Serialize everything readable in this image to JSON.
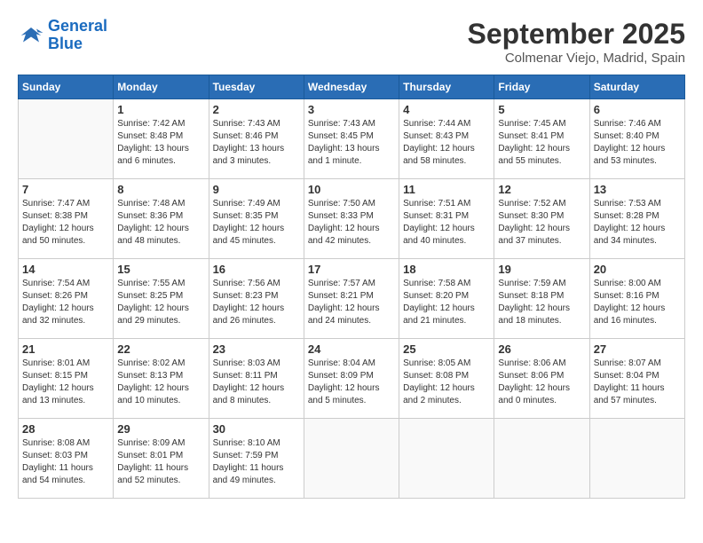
{
  "header": {
    "logo_line1": "General",
    "logo_line2": "Blue",
    "month_title": "September 2025",
    "location": "Colmenar Viejo, Madrid, Spain"
  },
  "weekdays": [
    "Sunday",
    "Monday",
    "Tuesday",
    "Wednesday",
    "Thursday",
    "Friday",
    "Saturday"
  ],
  "weeks": [
    [
      {
        "day": "",
        "sunrise": "",
        "sunset": "",
        "daylight": ""
      },
      {
        "day": "1",
        "sunrise": "Sunrise: 7:42 AM",
        "sunset": "Sunset: 8:48 PM",
        "daylight": "Daylight: 13 hours and 6 minutes."
      },
      {
        "day": "2",
        "sunrise": "Sunrise: 7:43 AM",
        "sunset": "Sunset: 8:46 PM",
        "daylight": "Daylight: 13 hours and 3 minutes."
      },
      {
        "day": "3",
        "sunrise": "Sunrise: 7:43 AM",
        "sunset": "Sunset: 8:45 PM",
        "daylight": "Daylight: 13 hours and 1 minute."
      },
      {
        "day": "4",
        "sunrise": "Sunrise: 7:44 AM",
        "sunset": "Sunset: 8:43 PM",
        "daylight": "Daylight: 12 hours and 58 minutes."
      },
      {
        "day": "5",
        "sunrise": "Sunrise: 7:45 AM",
        "sunset": "Sunset: 8:41 PM",
        "daylight": "Daylight: 12 hours and 55 minutes."
      },
      {
        "day": "6",
        "sunrise": "Sunrise: 7:46 AM",
        "sunset": "Sunset: 8:40 PM",
        "daylight": "Daylight: 12 hours and 53 minutes."
      }
    ],
    [
      {
        "day": "7",
        "sunrise": "Sunrise: 7:47 AM",
        "sunset": "Sunset: 8:38 PM",
        "daylight": "Daylight: 12 hours and 50 minutes."
      },
      {
        "day": "8",
        "sunrise": "Sunrise: 7:48 AM",
        "sunset": "Sunset: 8:36 PM",
        "daylight": "Daylight: 12 hours and 48 minutes."
      },
      {
        "day": "9",
        "sunrise": "Sunrise: 7:49 AM",
        "sunset": "Sunset: 8:35 PM",
        "daylight": "Daylight: 12 hours and 45 minutes."
      },
      {
        "day": "10",
        "sunrise": "Sunrise: 7:50 AM",
        "sunset": "Sunset: 8:33 PM",
        "daylight": "Daylight: 12 hours and 42 minutes."
      },
      {
        "day": "11",
        "sunrise": "Sunrise: 7:51 AM",
        "sunset": "Sunset: 8:31 PM",
        "daylight": "Daylight: 12 hours and 40 minutes."
      },
      {
        "day": "12",
        "sunrise": "Sunrise: 7:52 AM",
        "sunset": "Sunset: 8:30 PM",
        "daylight": "Daylight: 12 hours and 37 minutes."
      },
      {
        "day": "13",
        "sunrise": "Sunrise: 7:53 AM",
        "sunset": "Sunset: 8:28 PM",
        "daylight": "Daylight: 12 hours and 34 minutes."
      }
    ],
    [
      {
        "day": "14",
        "sunrise": "Sunrise: 7:54 AM",
        "sunset": "Sunset: 8:26 PM",
        "daylight": "Daylight: 12 hours and 32 minutes."
      },
      {
        "day": "15",
        "sunrise": "Sunrise: 7:55 AM",
        "sunset": "Sunset: 8:25 PM",
        "daylight": "Daylight: 12 hours and 29 minutes."
      },
      {
        "day": "16",
        "sunrise": "Sunrise: 7:56 AM",
        "sunset": "Sunset: 8:23 PM",
        "daylight": "Daylight: 12 hours and 26 minutes."
      },
      {
        "day": "17",
        "sunrise": "Sunrise: 7:57 AM",
        "sunset": "Sunset: 8:21 PM",
        "daylight": "Daylight: 12 hours and 24 minutes."
      },
      {
        "day": "18",
        "sunrise": "Sunrise: 7:58 AM",
        "sunset": "Sunset: 8:20 PM",
        "daylight": "Daylight: 12 hours and 21 minutes."
      },
      {
        "day": "19",
        "sunrise": "Sunrise: 7:59 AM",
        "sunset": "Sunset: 8:18 PM",
        "daylight": "Daylight: 12 hours and 18 minutes."
      },
      {
        "day": "20",
        "sunrise": "Sunrise: 8:00 AM",
        "sunset": "Sunset: 8:16 PM",
        "daylight": "Daylight: 12 hours and 16 minutes."
      }
    ],
    [
      {
        "day": "21",
        "sunrise": "Sunrise: 8:01 AM",
        "sunset": "Sunset: 8:15 PM",
        "daylight": "Daylight: 12 hours and 13 minutes."
      },
      {
        "day": "22",
        "sunrise": "Sunrise: 8:02 AM",
        "sunset": "Sunset: 8:13 PM",
        "daylight": "Daylight: 12 hours and 10 minutes."
      },
      {
        "day": "23",
        "sunrise": "Sunrise: 8:03 AM",
        "sunset": "Sunset: 8:11 PM",
        "daylight": "Daylight: 12 hours and 8 minutes."
      },
      {
        "day": "24",
        "sunrise": "Sunrise: 8:04 AM",
        "sunset": "Sunset: 8:09 PM",
        "daylight": "Daylight: 12 hours and 5 minutes."
      },
      {
        "day": "25",
        "sunrise": "Sunrise: 8:05 AM",
        "sunset": "Sunset: 8:08 PM",
        "daylight": "Daylight: 12 hours and 2 minutes."
      },
      {
        "day": "26",
        "sunrise": "Sunrise: 8:06 AM",
        "sunset": "Sunset: 8:06 PM",
        "daylight": "Daylight: 12 hours and 0 minutes."
      },
      {
        "day": "27",
        "sunrise": "Sunrise: 8:07 AM",
        "sunset": "Sunset: 8:04 PM",
        "daylight": "Daylight: 11 hours and 57 minutes."
      }
    ],
    [
      {
        "day": "28",
        "sunrise": "Sunrise: 8:08 AM",
        "sunset": "Sunset: 8:03 PM",
        "daylight": "Daylight: 11 hours and 54 minutes."
      },
      {
        "day": "29",
        "sunrise": "Sunrise: 8:09 AM",
        "sunset": "Sunset: 8:01 PM",
        "daylight": "Daylight: 11 hours and 52 minutes."
      },
      {
        "day": "30",
        "sunrise": "Sunrise: 8:10 AM",
        "sunset": "Sunset: 7:59 PM",
        "daylight": "Daylight: 11 hours and 49 minutes."
      },
      {
        "day": "",
        "sunrise": "",
        "sunset": "",
        "daylight": ""
      },
      {
        "day": "",
        "sunrise": "",
        "sunset": "",
        "daylight": ""
      },
      {
        "day": "",
        "sunrise": "",
        "sunset": "",
        "daylight": ""
      },
      {
        "day": "",
        "sunrise": "",
        "sunset": "",
        "daylight": ""
      }
    ]
  ]
}
